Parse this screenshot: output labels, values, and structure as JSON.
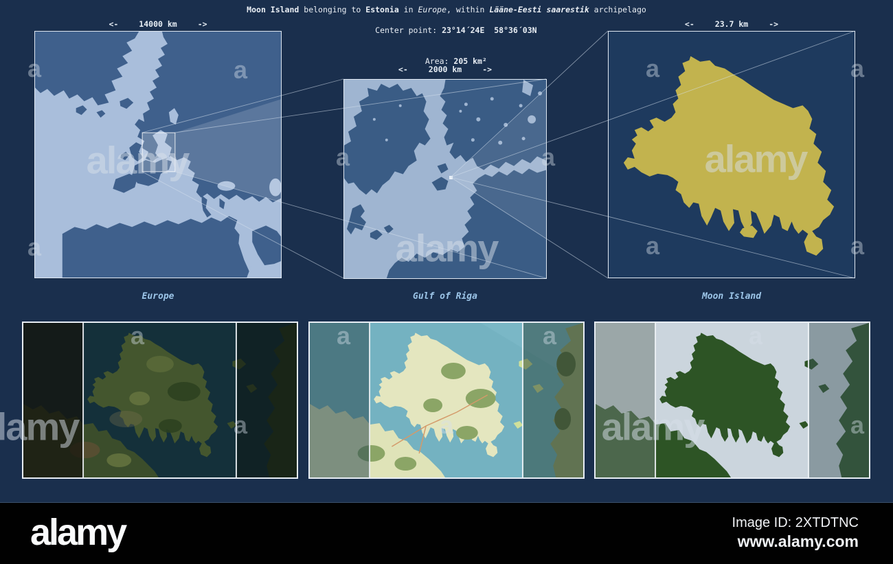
{
  "header": {
    "title_segments": [
      {
        "text": "Moon Island",
        "style": "bold"
      },
      {
        "text": " belonging to ",
        "style": "regular"
      },
      {
        "text": "Estonia",
        "style": "bold"
      },
      {
        "text": " in ",
        "style": "regular"
      },
      {
        "text": "Europe",
        "style": "italic"
      },
      {
        "text": ", within ",
        "style": "regular"
      },
      {
        "text": "Lääne-Eesti saarestik",
        "style": "bold-italic"
      },
      {
        "text": " archipelago",
        "style": "regular"
      }
    ],
    "center_point_label": "Center point: ",
    "center_point_value": "23°14´24E  58°36´03N",
    "area_label": "Area: ",
    "area_value": "205 km²"
  },
  "maps": {
    "europe": {
      "caption": "Europe",
      "scale": "14000 km",
      "arrow_left": "<-",
      "arrow_right": "->"
    },
    "gulf_of_riga": {
      "caption": "Gulf of Riga",
      "scale": "2000 km",
      "arrow_left": "<-",
      "arrow_right": "->"
    },
    "moon_island": {
      "caption": "Moon Island",
      "scale": "23.7 km",
      "arrow_left": "<-",
      "arrow_right": "->"
    }
  },
  "watermark": {
    "word": "alamy",
    "letter": "a"
  },
  "footer": {
    "logo": "alamy",
    "image_id": "Image ID: 2XTDTNC",
    "website": "www.alamy.com"
  },
  "colors": {
    "page_background": "#1a2f4d",
    "europe_ocean": "#a9bedb",
    "europe_land": "#3f608c",
    "gulf_sea": "#9fb5d1",
    "gulf_land": "#3a5c85",
    "island_map_bg": "#1e3a5e",
    "island_yellow": "#c2b34e",
    "caption_blue": "#9cc5e8",
    "title_text": "#e9eef4",
    "connector_line": "#d7e2ee",
    "sat_water": "#14303a",
    "sat_land": "#44562e",
    "osm_water": "#74b2c1",
    "osm_land": "#e4e6bf",
    "osm_forest": "#8ba566",
    "plain_water": "#cbd5dd",
    "plain_land": "#2d5425",
    "footer_bg": "#010101"
  }
}
